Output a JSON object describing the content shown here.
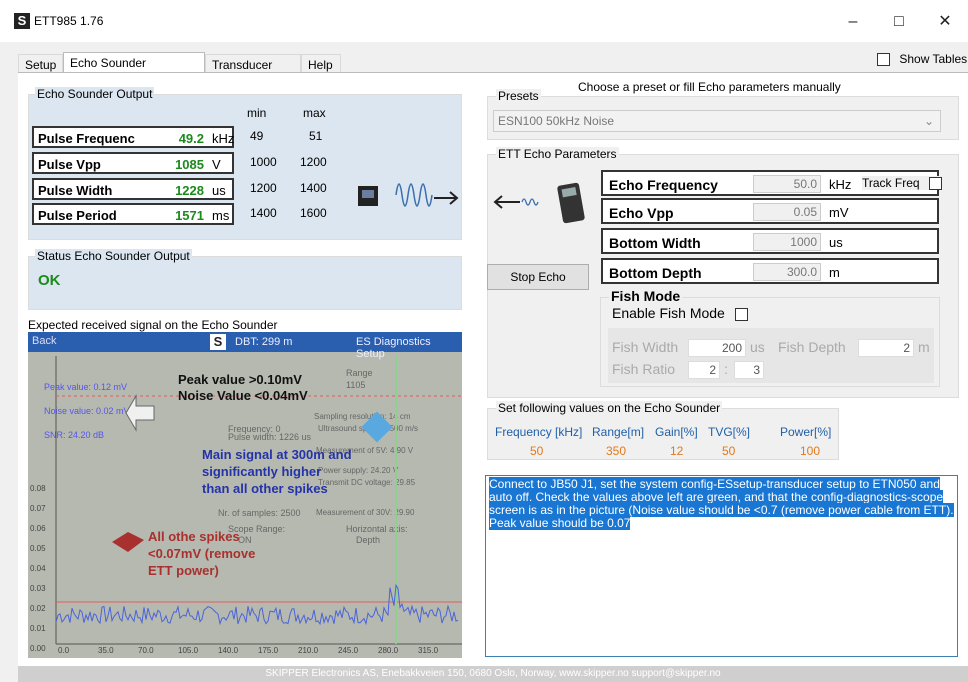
{
  "window": {
    "title": "ETT985 1.76",
    "app_icon": "S",
    "minimize": "–",
    "maximize": "□",
    "close": "✕"
  },
  "tabs": [
    {
      "label": "Setup"
    },
    {
      "label": "Echo Sounder Simulator"
    },
    {
      "label": "Transducer Test"
    },
    {
      "label": "Help"
    }
  ],
  "show_tables": {
    "label": "Show Tables",
    "checked": false
  },
  "echo_output": {
    "title": "Echo Sounder Output",
    "min_header": "min",
    "max_header": "max",
    "rows": [
      {
        "label": "Pulse Frequenc",
        "value": "49.2",
        "unit": "kHz",
        "min": "49",
        "max": "51"
      },
      {
        "label": "Pulse Vpp",
        "value": "1085",
        "unit": "V",
        "min": "1000",
        "max": "1200"
      },
      {
        "label": "Pulse Width",
        "value": "1228",
        "unit": "us",
        "min": "1200",
        "max": "1400"
      },
      {
        "label": "Pulse Period",
        "value": "1571",
        "unit": "ms",
        "min": "1400",
        "max": "1600"
      }
    ]
  },
  "status": {
    "title": "Status Echo Sounder Output",
    "value": "OK"
  },
  "signal": {
    "title": "Expected received signal on the Echo Sounder",
    "screen": {
      "back": "Back",
      "logo": "S",
      "dbt": "DBT: 299 m",
      "diag": "ES Diagnostics Setup",
      "peak": "Peak value: 0.12 mV",
      "noise": "Noise value: 0.02 mV",
      "snr": "SNR: 24.20 dB",
      "freq": "Frequency: 0",
      "pw": "Pulse width: 1226 us",
      "nsamp": "Nr. of samples: 2500",
      "range_lbl": "Range",
      "range_val": "1105",
      "scope_range": "Scope Range:",
      "scope_val": "ON",
      "samp": "Sampling resolution: 14 cm",
      "ultra": "Ultrasound speed: 1500 m/s",
      "m5": "Measurement of 5V: 4.90 V",
      "supply": "Power supply: 24.20 V",
      "txdc": "Transmit DC voltage: 29.85",
      "m30": "Measurement of 30V: 29.90",
      "hax": "Horizontal axis:",
      "hax_v": "Depth",
      "yticks": [
        "0.08",
        "0.07",
        "0.06",
        "0.05",
        "0.04",
        "0.03",
        "0.02",
        "0.01",
        "0.00"
      ],
      "xticks": [
        "0.0",
        "35.0",
        "70.0",
        "105.0",
        "140.0",
        "175.0",
        "210.0",
        "245.0",
        "280.0",
        "315.0"
      ]
    },
    "ann1": "Peak value >0.10mV",
    "ann2": "Noise Value <0.04mV",
    "ann3": "Main signal at 300m and significantly higher than all other spikes",
    "ann4": "All othe spikes <0.07mV (remove ETT power)"
  },
  "right_title": "Choose a preset or fill Echo parameters manually",
  "presets": {
    "title": "Presets",
    "selected": "ESN100 50kHz Noise"
  },
  "ett": {
    "title": "ETT Echo Parameters",
    "rows": [
      {
        "label": "Echo Frequency",
        "value": "50.0",
        "unit": "kHz"
      },
      {
        "label": "Echo Vpp",
        "value": "0.05",
        "unit": "mV"
      },
      {
        "label": "Bottom Width",
        "value": "1000",
        "unit": "us"
      },
      {
        "label": "Bottom Depth",
        "value": "300.0",
        "unit": "m"
      }
    ],
    "track_freq": "Track Freq",
    "stop_button": "Stop Echo"
  },
  "fish": {
    "title": "Fish Mode",
    "enable": "Enable Fish Mode",
    "width_label": "Fish Width",
    "width_value": "200",
    "width_unit": "us",
    "depth_label": "Fish Depth",
    "depth_value": "2",
    "depth_unit": "m",
    "ratio_label": "Fish Ratio",
    "ratio_a": "2",
    "ratio_sep": ":",
    "ratio_b": "3"
  },
  "set_values": {
    "title": "Set following values on the Echo Sounder",
    "headers": [
      "Frequency [kHz]",
      "Range[m]",
      "Gain[%]",
      "TVG[%]",
      "Power[%]"
    ],
    "values": [
      "50",
      "350",
      "12",
      "50",
      "100"
    ]
  },
  "instructions": "Connect to JB50 J1, set the system config-ESsetup-transducer setup to ETN050 and auto off. Check the values above left are green, and that the config-diagnostics-scope screen is as in the picture (Noise value should be <0.7 (remove power cable from ETT). Peak value should be 0.07",
  "footer": "SKIPPER Electronics AS, Enebakkveien 150, 0680 Oslo, Norway, www.skipper.no support@skipper.no",
  "colors": {
    "good": "#1c8a1c",
    "panel_blue": "#dce6f0",
    "header_blue": "#1f5fa8",
    "value_orange": "#e07a1a",
    "selection": "#1976d2"
  }
}
